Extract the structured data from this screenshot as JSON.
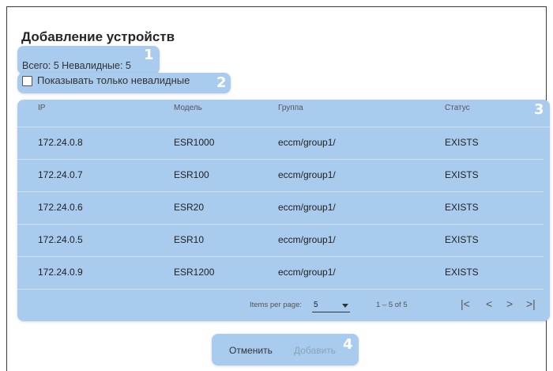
{
  "dialog": {
    "title": "Добавление устройств",
    "counts_text": "Всего: 5 Невалидные: 5",
    "filter_label": "Показывать только невалидные"
  },
  "badges": [
    "1",
    "2",
    "3",
    "4"
  ],
  "table": {
    "headers": [
      "IP",
      "Модель",
      "Группа",
      "Статус"
    ],
    "rows": [
      [
        "172.24.0.8",
        "ESR1000",
        "eccm/group1/",
        "EXISTS"
      ],
      [
        "172.24.0.7",
        "ESR100",
        "eccm/group1/",
        "EXISTS"
      ],
      [
        "172.24.0.6",
        "ESR20",
        "eccm/group1/",
        "EXISTS"
      ],
      [
        "172.24.0.5",
        "ESR10",
        "eccm/group1/",
        "EXISTS"
      ],
      [
        "172.24.0.9",
        "ESR1200",
        "eccm/group1/",
        "EXISTS"
      ]
    ]
  },
  "paginator": {
    "items_per_page_label": "Items per page:",
    "page_size": "5",
    "range_label": "1 – 5 of 5",
    "first_icon": "|<",
    "prev_icon": "<",
    "next_icon": ">",
    "last_icon": ">|"
  },
  "actions": {
    "cancel_label": "Отменить",
    "add_label": "Добавить"
  },
  "colors": {
    "highlight": "#a9cbee",
    "badge": "#ffffff",
    "disabled_text": "#8aa3bd"
  }
}
